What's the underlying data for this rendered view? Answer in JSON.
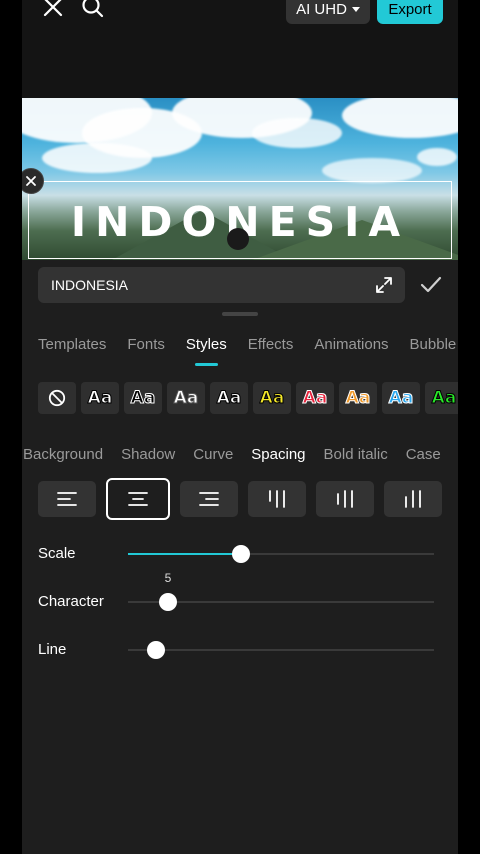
{
  "topbar": {
    "quality_label": "AI UHD",
    "export_label": "Export"
  },
  "preview": {
    "overlay_text": "INDONESIA"
  },
  "editor": {
    "text_value": "INDONESIA"
  },
  "tabs": [
    {
      "label": "Templates",
      "active": false
    },
    {
      "label": "Fonts",
      "active": false
    },
    {
      "label": "Styles",
      "active": true
    },
    {
      "label": "Effects",
      "active": false
    },
    {
      "label": "Animations",
      "active": false
    },
    {
      "label": "Bubble",
      "active": false
    }
  ],
  "style_presets": [
    {
      "label": "Aa",
      "fill": "#ffffff",
      "stroke": "#000000"
    },
    {
      "label": "Aa",
      "fill": "#000000",
      "stroke": "#ffffff"
    },
    {
      "label": "Aa",
      "fill": "#ffffff",
      "stroke": "#555555"
    },
    {
      "label": "Aa",
      "fill": "#ffffff",
      "stroke": "#000000"
    },
    {
      "label": "Aa",
      "fill": "#f5e92a",
      "stroke": "#000000"
    },
    {
      "label": "Aa",
      "fill": "#e8213a",
      "stroke": "#ffffff"
    },
    {
      "label": "Aa",
      "fill": "#f09a2a",
      "stroke": "#ffffff"
    },
    {
      "label": "Aa",
      "fill": "#2aa8f0",
      "stroke": "#ffffff"
    },
    {
      "label": "Aa",
      "fill": "#2ae82a",
      "stroke": "#000000"
    }
  ],
  "subtabs": [
    {
      "label": "Background",
      "active": false
    },
    {
      "label": "Shadow",
      "active": false
    },
    {
      "label": "Curve",
      "active": false
    },
    {
      "label": "Spacing",
      "active": true
    },
    {
      "label": "Bold italic",
      "active": false
    },
    {
      "label": "Case",
      "active": false
    }
  ],
  "alignment": {
    "options": [
      "align-left",
      "align-center",
      "align-right",
      "vertical-top",
      "vertical-center",
      "vertical-bottom"
    ],
    "selected": "align-center"
  },
  "sliders": {
    "scale": {
      "label": "Scale",
      "fraction": 0.37
    },
    "character": {
      "label": "Character",
      "value": "5",
      "fraction": 0.13
    },
    "line": {
      "label": "Line",
      "fraction": 0.09
    }
  },
  "colors": {
    "accent": "#22c9d6",
    "panel": "#1e1e1e"
  }
}
